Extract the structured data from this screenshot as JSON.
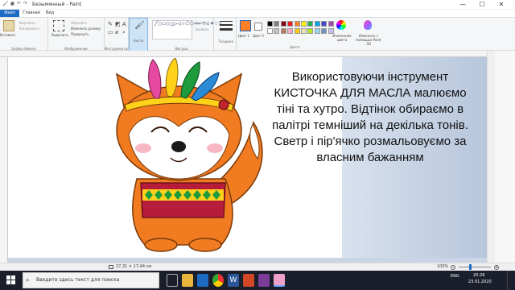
{
  "window": {
    "title": "Безымянный - Paint",
    "minimize": "—",
    "maximize": "☐",
    "close": "✕"
  },
  "tabs": [
    "Файл",
    "Главная",
    "Вид"
  ],
  "ribbon": {
    "clipboard": {
      "paste": "Вставить",
      "cut": "Вырезать",
      "copy": "Копировать",
      "label": "Буфер обмена"
    },
    "image": {
      "select": "Выделить",
      "crop": "Обрезать",
      "resize": "Изменить размер",
      "rotate": "Повернуть",
      "label": "Изображение"
    },
    "tools": {
      "label": "Инструменты"
    },
    "brushes": {
      "label": "Кисти"
    },
    "shapes": {
      "outline": "Контур",
      "fill": "Заливка",
      "label": "Фигуры"
    },
    "size": {
      "label": "Толщина"
    },
    "color1": "Цвет 1",
    "color2": "Цвет 2",
    "colors_label": "Цвета",
    "edit_colors": "Изменение цвета",
    "paint3d": "Изменить с помощью Paint 3D",
    "palette": [
      "#000000",
      "#7f7f7f",
      "#880015",
      "#ed1c24",
      "#ff7f27",
      "#fff200",
      "#22b14c",
      "#00a2e8",
      "#3f48cc",
      "#a349a4",
      "#ffffff",
      "#c3c3c3",
      "#b97a57",
      "#ffaec9",
      "#ffc90e",
      "#efe4b0",
      "#b5e61d",
      "#99d9ea",
      "#7092be",
      "#c8bfe7"
    ]
  },
  "canvas_text": "Використовуючи інструмент КИСТОЧКА ДЛЯ МАСЛА малюємо тіні та хутро. Відтінок обираємо в палітрі темніший на декілька тонів. Светр і пір'ячко розмальовуємо за власним бажанням",
  "status": {
    "dimensions": "27,31 × 17,44 см",
    "zoom": "100%"
  },
  "taskbar": {
    "search_placeholder": "Введите здесь текст для поиска",
    "lang": "ENG",
    "time": "20:26",
    "date": "23.01.2020"
  }
}
